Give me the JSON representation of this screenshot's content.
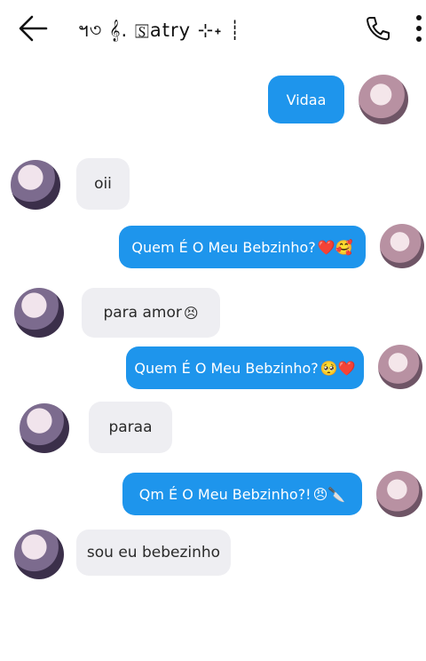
{
  "header": {
    "title": "ฯ৩ 𝄞. 🅂atry ⊹˖ ┊",
    "back_icon": "arrow-left-icon",
    "call_icon": "phone-icon",
    "menu_icon": "more-vertical-icon"
  },
  "colors": {
    "outgoing_bubble": "#1e95ec",
    "incoming_bubble": "#eeeef2",
    "background": "#ffffff"
  },
  "messages": [
    {
      "side": "out",
      "text": "Vidaa",
      "emoji": ""
    },
    {
      "side": "in",
      "text": "oii",
      "emoji": ""
    },
    {
      "side": "out",
      "text": "Quem É O Meu Bebzinho?",
      "emoji": "❤️🥰"
    },
    {
      "side": "in",
      "text": "para amor",
      "emoji": "😣"
    },
    {
      "side": "out",
      "text": "Quem É O Meu Bebzinho?",
      "emoji": "🥺❤️"
    },
    {
      "side": "in",
      "text": "paraa",
      "emoji": ""
    },
    {
      "side": "out",
      "text": "Qm É O Meu Bebzinho?!",
      "emoji": "😠🔪"
    },
    {
      "side": "in",
      "text": "sou eu bebezinho",
      "emoji": ""
    }
  ]
}
